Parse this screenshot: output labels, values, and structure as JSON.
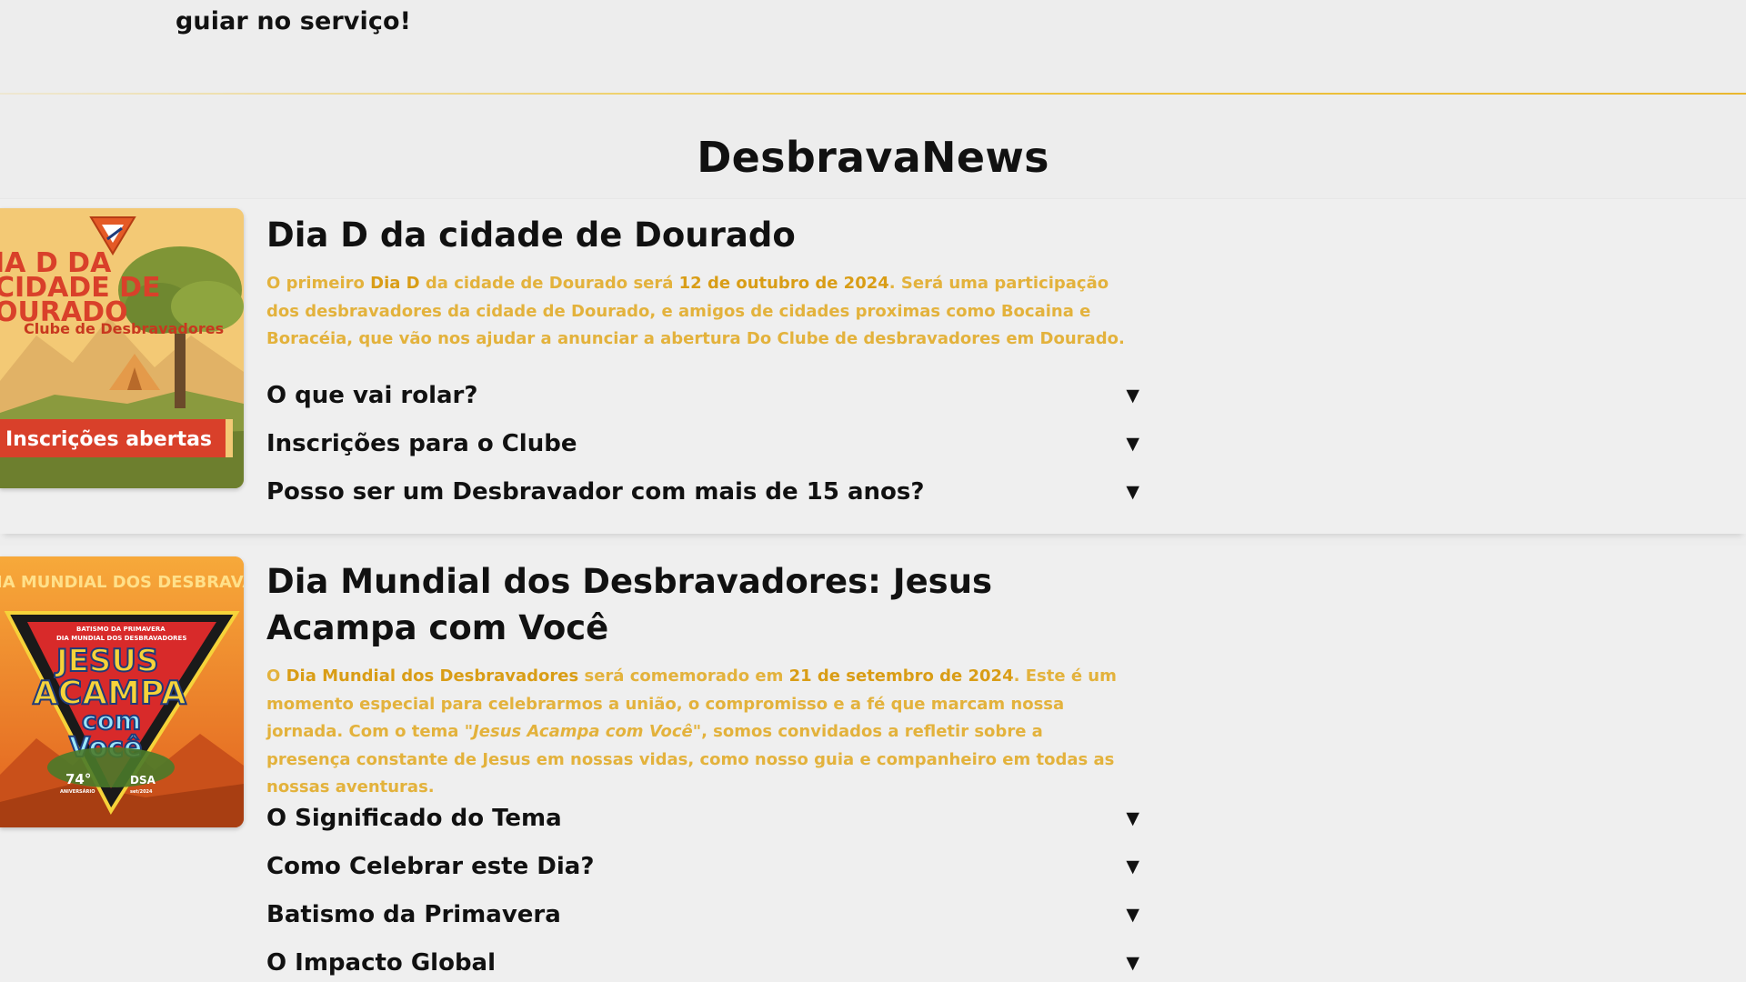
{
  "intro": {
    "text": "guiar no serviço!"
  },
  "section": {
    "title": "DesbravaNews"
  },
  "news": [
    {
      "title": "Dia D da cidade de Dourado",
      "body": {
        "p1": "O primeiro ",
        "h1": "Dia D",
        "p2": " da cidade de Dourado será ",
        "h2": "12 de outubro de 2024",
        "p3": ". Será uma participação dos desbravadores da cidade de Dourado, e amigos de cidades proximas como Bocaina e Boracéia, que vão nos ajudar a anunciar a abertura Do Clube de desbravadores em Dourado."
      },
      "image": {
        "line1": "IA D DA",
        "line2": "CIDADE DE",
        "line3": "OURADO",
        "subtitle": "Clube de Desbravadores",
        "banner": "Inscrições abertas"
      },
      "faqs": [
        "O que vai rolar?",
        "Inscrições para o Clube",
        "Posso ser um Desbravador com mais de 15 anos?"
      ]
    },
    {
      "title": "Dia Mundial dos Desbravadores: Jesus Acampa com Você",
      "body": {
        "p1": "O ",
        "h1": "Dia Mundial dos Desbravadores",
        "p2": " será comemorado em ",
        "h2": "21 de setembro de 2024",
        "p3": ". Este é um momento especial para celebrarmos a união, o compromisso e a fé que marcam nossa jornada. Com o tema ",
        "em": "\"Jesus Acampa com Você\"",
        "p4": ", somos convidados a refletir sobre a presença constante de Jesus em nossas vidas, como nosso guia e companheiro em todas as nossas aventuras."
      },
      "image": {
        "header": "IA MUNDIAL DOS DESBRAVADORES",
        "small1": "BATISMO DA PRIMAVERA",
        "small2": "DIA MUNDIAL DOS DESBRAVADORES",
        "word1": "JESUS",
        "word2": "ACAMPA",
        "word3": "com",
        "word4": "Você",
        "badge": "74°",
        "badge_sub": "ANIVERSÁRIO",
        "dsa": "DSA",
        "dsa_sub": "set/2024"
      },
      "faqs": [
        "O Significado do Tema",
        "Como Celebrar este Dia?",
        "Batismo da Primavera",
        "O Impacto Global"
      ]
    }
  ],
  "ui": {
    "arrow": "▼"
  },
  "colors": {
    "background": "#ededed",
    "body_text": "#e3b23c",
    "highlight": "#d99d16",
    "divider": "#f0c846",
    "poster1_bg": "#f3c975",
    "poster1_title": "#d9402a",
    "poster2_bg": "#f48c2a"
  }
}
